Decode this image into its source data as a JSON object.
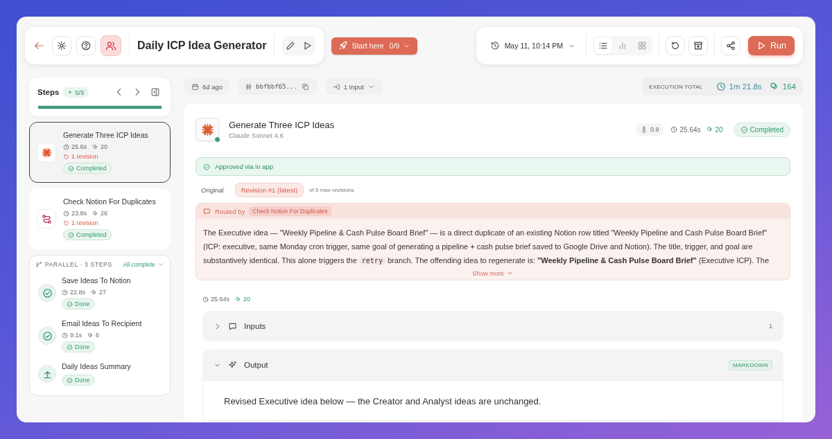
{
  "header": {
    "title": "Daily ICP Idea Generator",
    "start_button": {
      "label": "Start here",
      "progress": "0/9"
    },
    "run_time": "May 11, 10:14 PM",
    "views": [
      {
        "kind": "list",
        "selected": true
      },
      {
        "kind": "chart",
        "selected": false
      },
      {
        "kind": "grid",
        "selected": false
      }
    ],
    "run_button": "Run"
  },
  "steps": {
    "title": "Steps",
    "count": "5/5",
    "level": 1,
    "items": [
      {
        "kind": "llm",
        "name": "Generate Three ICP Ideas",
        "time": "25.6s",
        "tokens": "20",
        "revision": "1 revision",
        "status": "Completed",
        "selected": true
      },
      {
        "kind": "router",
        "name": "Check Notion For Duplicates",
        "time": "23.8s",
        "tokens": "26",
        "revision": "1 revision",
        "status": "Completed",
        "selected": false
      }
    ],
    "parallel": {
      "label": "PARALLEL · 3 STEPS",
      "summary": "All complete",
      "items": [
        {
          "kind": "check",
          "name": "Save Ideas To Notion",
          "time": "22.8s",
          "tokens": "27",
          "status": "Done"
        },
        {
          "kind": "check",
          "name": "Email Ideas To Recipient",
          "time": "9.1s",
          "tokens": "6",
          "status": "Done"
        },
        {
          "kind": "upload",
          "name": "Daily Ideas Summary",
          "status": "Done"
        }
      ]
    }
  },
  "run_info": {
    "age": "6d ago",
    "hash": "bbfbbf65...",
    "inputs": "1 Input",
    "total_label": "EXECUTION TOTAL",
    "total_time": "1m 21.8s",
    "total_tokens": "164"
  },
  "detail": {
    "title": "Generate Three ICP Ideas",
    "model": "Claude Sonnet 4.6",
    "temperature": "0.9",
    "time": "25.64s",
    "tokens": "20",
    "status": "Completed",
    "approval": "Approved via in app",
    "revisions": [
      {
        "label": "Original",
        "selected": false
      },
      {
        "label": "Revision #1 (latest)",
        "selected": true
      }
    ],
    "revision_note": "of 5 max revisions",
    "routed_label": "Routed by",
    "routed_from": "Check Notion For Duplicates",
    "reason": [
      {
        "kind": "text",
        "text": "The Executive idea — \"Weekly Pipeline & Cash Pulse Board Brief\" — is a direct duplicate of an existing Notion row titled \"Weekly Pipeline and Cash Pulse Board Brief\" (ICP: executive, same Monday cron trigger, same goal of generating a pipeline + cash pulse brief saved to Google Drive and Notion). The title, trigger, and goal are substantively identical. This alone triggers the "
      },
      {
        "kind": "code",
        "text": "retry"
      },
      {
        "kind": "text",
        "text": " branch. The offending idea to regenerate is: **\"Weekly Pipeline & Cash Pulse Board Brief\"** (Executive ICP). The"
      }
    ],
    "show_more": "Show more",
    "run_time": "25.64s",
    "run_tokens": "20",
    "sections": [
      {
        "kind": "inputs",
        "title": "Inputs",
        "count": "1",
        "expanded": false
      },
      {
        "kind": "output",
        "title": "Output",
        "format": "MARKDOWN",
        "expanded": true,
        "body": "Revised Executive idea below — the Creator and Analyst ideas are unchanged."
      }
    ]
  }
}
